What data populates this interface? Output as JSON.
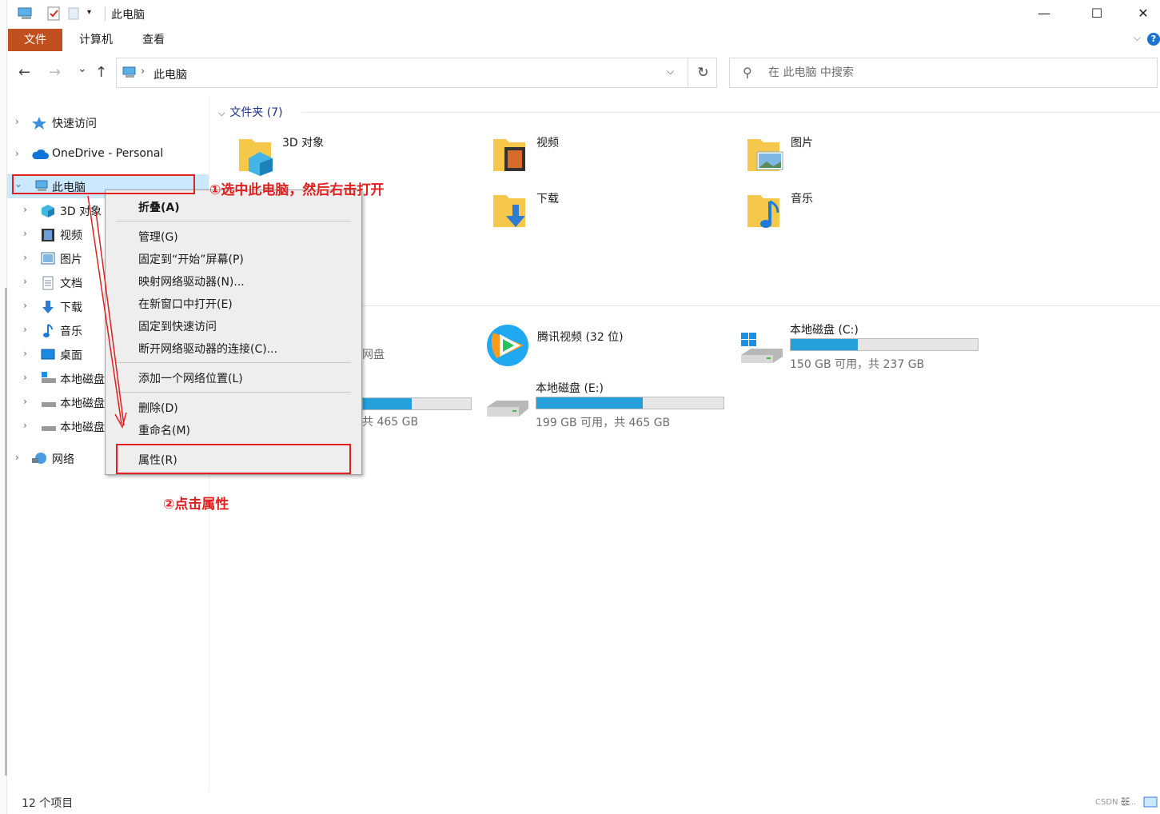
{
  "window": {
    "title": "此电脑",
    "minimize": "—",
    "maximize": "☐",
    "close": "✕"
  },
  "ribbon": {
    "tabs": [
      "文件",
      "计算机",
      "查看"
    ],
    "help": "?"
  },
  "address": {
    "back": "←",
    "forward": "→",
    "recent": "⌄",
    "up": "↑",
    "separator": "›",
    "path": "此电脑",
    "dropdown": "⌵",
    "refresh": "↻"
  },
  "search": {
    "placeholder": "在 此电脑 中搜索"
  },
  "sidebar": {
    "items": [
      {
        "label": "快速访问"
      },
      {
        "label": "OneDrive - Personal"
      },
      {
        "label": "此电脑"
      },
      {
        "label": "3D 对象"
      },
      {
        "label": "视频"
      },
      {
        "label": "图片"
      },
      {
        "label": "文档"
      },
      {
        "label": "下载"
      },
      {
        "label": "音乐"
      },
      {
        "label": "桌面"
      },
      {
        "label": "本地磁盘"
      },
      {
        "label": "本地磁盘"
      },
      {
        "label": "本地磁盘"
      },
      {
        "label": "网络"
      }
    ]
  },
  "content": {
    "folders_header": "文件夹 (7)",
    "folders": [
      "3D 对象",
      "视频",
      "图片",
      "下载",
      "音乐"
    ],
    "partial_drive_label": "网盘",
    "partial_drive_free": "共 465 GB",
    "partial_drive_fill": 0.45,
    "drives": [
      {
        "name": "腾讯视频 (32 位)"
      },
      {
        "name": "本地磁盘 (C:)",
        "free": "150 GB 可用，共 237 GB",
        "used_fraction": 0.36
      },
      {
        "name": "本地磁盘 (E:)",
        "free": "199 GB 可用，共 465 GB",
        "used_fraction": 0.57
      }
    ]
  },
  "context_menu": {
    "items": [
      "折叠(A)",
      "管理(G)",
      "固定到“开始”屏幕(P)",
      "映射网络驱动器(N)...",
      "在新窗口中打开(E)",
      "固定到快速访问",
      "断开网络驱动器的连接(C)...",
      "添加一个网络位置(L)",
      "删除(D)",
      "重命名(M)",
      "属性(R)"
    ]
  },
  "annotations": {
    "step1": "①选中此电脑，然后右击打开",
    "step2": "②点击属性"
  },
  "status": {
    "item_count": "12 个项目"
  },
  "watermark": "CSDN @..."
}
